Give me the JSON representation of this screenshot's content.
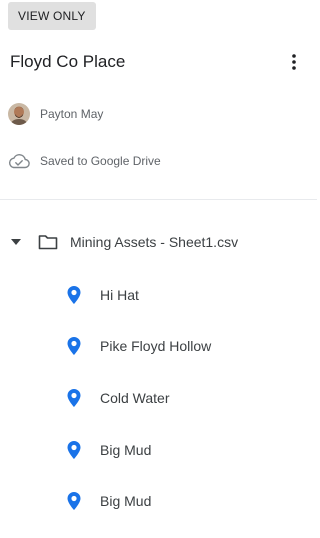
{
  "badge": "VIEW ONLY",
  "map_title": "Floyd Co Place",
  "owner": "Payton May",
  "save_status": "Saved to Google Drive",
  "layer": {
    "name": "Mining Assets - Sheet1.csv"
  },
  "places": [
    {
      "label": "Hi Hat"
    },
    {
      "label": "Pike Floyd Hollow"
    },
    {
      "label": "Cold Water"
    },
    {
      "label": "Big Mud"
    },
    {
      "label": "Big Mud"
    }
  ],
  "colors": {
    "pin": "#1a73e8",
    "badge_bg": "#e0e0e0",
    "text_primary": "#202124",
    "text_secondary": "#5f6368"
  },
  "icons": {
    "more": "more-vert-icon",
    "cloud": "cloud-check-icon",
    "caret": "caret-down-icon",
    "folder": "folder-icon",
    "pin": "map-pin-icon"
  }
}
